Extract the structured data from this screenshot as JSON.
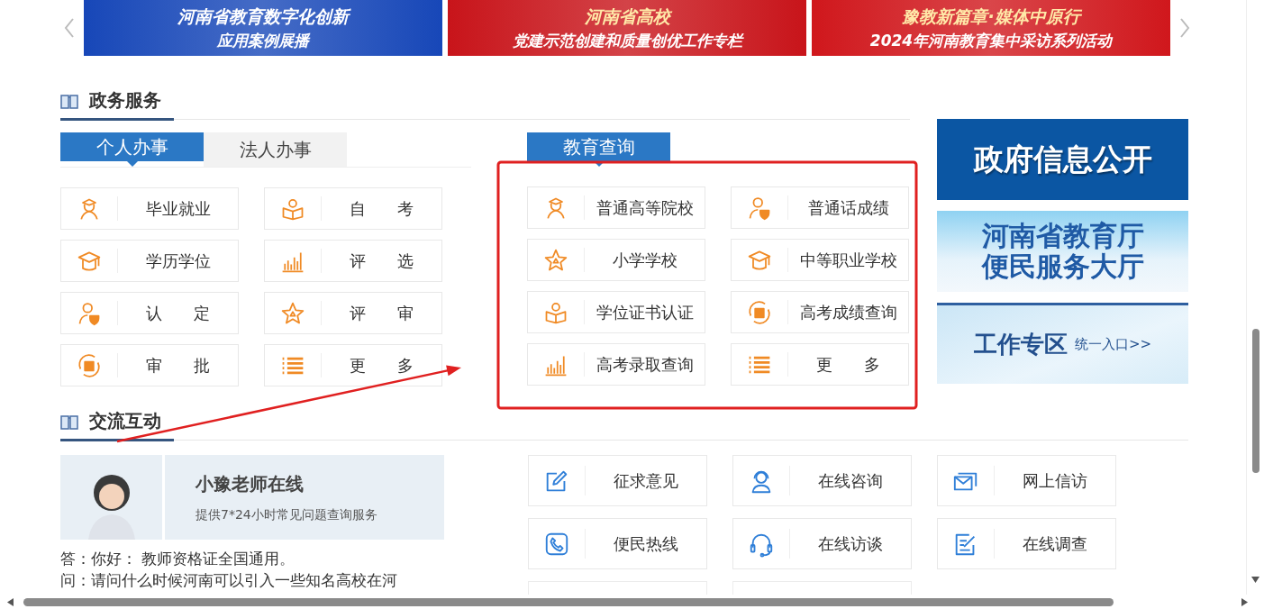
{
  "banners": [
    {
      "line_1": "河南省教育数字化创新",
      "line_2": "应用案例展播",
      "color": "#1747b8"
    },
    {
      "line_1": "河南省高校",
      "line_2": "党建示范创建和质量创优工作专栏",
      "color": "#c8141a"
    },
    {
      "line_1": "豫教新篇章·媒体中原行",
      "line_2": "2024年河南教育集中采访系列活动",
      "color": "#d0171c"
    }
  ],
  "gov_services": {
    "title": "政务服务",
    "tabs": [
      {
        "label": "个人办事",
        "selected": true
      },
      {
        "label": "法人办事",
        "selected": false
      }
    ],
    "items": [
      {
        "kind": "graduate",
        "label": "毕业就业"
      },
      {
        "kind": "selfstudy",
        "label": "自 考"
      },
      {
        "kind": "cap",
        "label": "学历学位"
      },
      {
        "kind": "chart",
        "label": "评 选"
      },
      {
        "kind": "certify",
        "label": "认 定"
      },
      {
        "kind": "star",
        "label": "评 审"
      },
      {
        "kind": "approval",
        "label": "审 批"
      },
      {
        "kind": "list",
        "label": "更 多"
      }
    ]
  },
  "edu_query": {
    "tabs": [
      {
        "label": "教育查询",
        "selected": true
      }
    ],
    "items": [
      {
        "kind": "graduate",
        "label": "普通高等院校"
      },
      {
        "kind": "certify",
        "label": "普通话成绩"
      },
      {
        "kind": "star",
        "label": "小学学校"
      },
      {
        "kind": "cap",
        "label": "中等职业学校"
      },
      {
        "kind": "selfstudy",
        "label": "学位证书认证"
      },
      {
        "kind": "approval",
        "label": "高考成绩查询"
      },
      {
        "kind": "chart",
        "label": "高考录取查询"
      },
      {
        "kind": "list",
        "label": "更 多"
      }
    ]
  },
  "side_links": [
    {
      "kind": "gov_info",
      "lines": [
        "政府信息公开"
      ]
    },
    {
      "kind": "service_hall",
      "lines": [
        "河南省教育厅",
        "便民服务大厅"
      ]
    },
    {
      "kind": "work_zone",
      "lines": [
        "工作专区",
        "统一入口>>"
      ]
    }
  ],
  "interaction": {
    "title": "交流互动",
    "teacher": {
      "name": "小豫老师在线",
      "description": "提供7*24小时常见问题查询服务"
    },
    "qa": [
      "答：你好： 教师资格证全国通用。",
      "问：请问什么时候河南可以引入一些知名高校在河"
    ],
    "items": [
      {
        "kind": "edit",
        "label": "征求意见"
      },
      {
        "kind": "support",
        "label": "在线咨询"
      },
      {
        "kind": "mail",
        "label": "网上信访"
      },
      {
        "kind": "phone",
        "label": "便民热线"
      },
      {
        "kind": "headset",
        "label": "在线访谈"
      },
      {
        "kind": "survey",
        "label": "在线调查"
      }
    ]
  }
}
